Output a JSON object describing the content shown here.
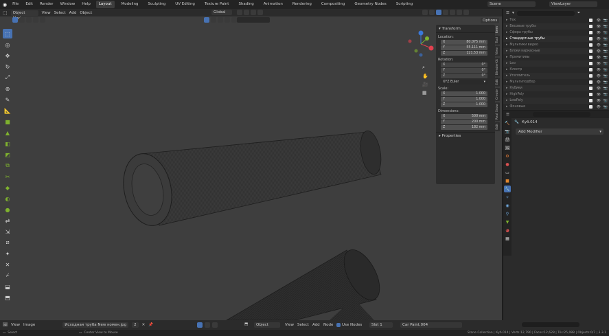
{
  "topbar": {
    "menus": [
      "File",
      "Edit",
      "Render",
      "Window",
      "Help"
    ],
    "workspaces": [
      "Layout",
      "Modeling",
      "Sculpting",
      "UV Editing",
      "Texture Paint",
      "Shading",
      "Animation",
      "Rendering",
      "Compositing",
      "Geometry Nodes",
      "Scripting"
    ],
    "active_workspace": "Layout",
    "scene": "Scene",
    "view_layer": "ViewLayer"
  },
  "view_header": {
    "mode": "Object Mode",
    "menus": [
      "View",
      "Select",
      "Add",
      "Object"
    ],
    "orientation": "Global",
    "options": "Options"
  },
  "npanel": {
    "section_transform": "Transform",
    "location_label": "Location:",
    "location": [
      {
        "axis": "X",
        "value": "80.075 mm"
      },
      {
        "axis": "Y",
        "value": "55.111 mm"
      },
      {
        "axis": "Z",
        "value": "121.53 mm"
      }
    ],
    "rotation_label": "Rotation:",
    "rotation": [
      {
        "axis": "X",
        "value": "0°"
      },
      {
        "axis": "Y",
        "value": "0°"
      },
      {
        "axis": "Z",
        "value": "0°"
      }
    ],
    "rotation_mode": "XYZ Euler",
    "scale_label": "Scale:",
    "scale": [
      {
        "axis": "X",
        "value": "1.000"
      },
      {
        "axis": "Y",
        "value": "1.000"
      },
      {
        "axis": "Z",
        "value": "1.000"
      }
    ],
    "dimensions_label": "Dimensions:",
    "dimensions": [
      {
        "axis": "X",
        "value": "500 mm"
      },
      {
        "axis": "Y",
        "value": "200 mm"
      },
      {
        "axis": "Z",
        "value": "182 mm"
      }
    ],
    "section_properties": "Properties",
    "tabs": [
      "Item",
      "Tool",
      "View",
      "BlenderKit",
      "Edit",
      "Create",
      "Real Snow",
      "Edit"
    ]
  },
  "outliner": {
    "items": [
      "Тех",
      "Бесовые трубы",
      "Сфера трубы",
      "Стандартные трубы",
      "Мультики видео",
      "Блоки каркасные",
      "Примитивы",
      "Leo",
      "Клостр",
      "Утеплитель",
      "Мультиподбор",
      "Кубики",
      "HighPoly",
      "LowPoly",
      "Фоновые"
    ],
    "active_index": 3
  },
  "properties": {
    "object_name": "Куб.014",
    "add_modifier": "Add Modifier"
  },
  "bottom_header": {
    "menus1": [
      "View",
      "Image"
    ],
    "image_name": "Исходная трубa New комен.jpg",
    "image_users": "2",
    "object_menu": "Object",
    "menus2": [
      "View",
      "Select",
      "Add",
      "Node"
    ],
    "use_nodes": "Use Nodes",
    "slot": "Slot 1",
    "material": "Car Paint.004"
  },
  "status": {
    "left": "Select",
    "mid": "Center View to Mouse",
    "right": "Stane Collection | Куб.014 | Verts:12,790 | Faces:12,628 | Tris:25,088 | Objects:0/7 | 3.3.1"
  },
  "colors": {
    "accent": "#4772b3",
    "x_axis": "#e2414f",
    "y_axis": "#7fb22e",
    "z_axis": "#3b79d9"
  }
}
